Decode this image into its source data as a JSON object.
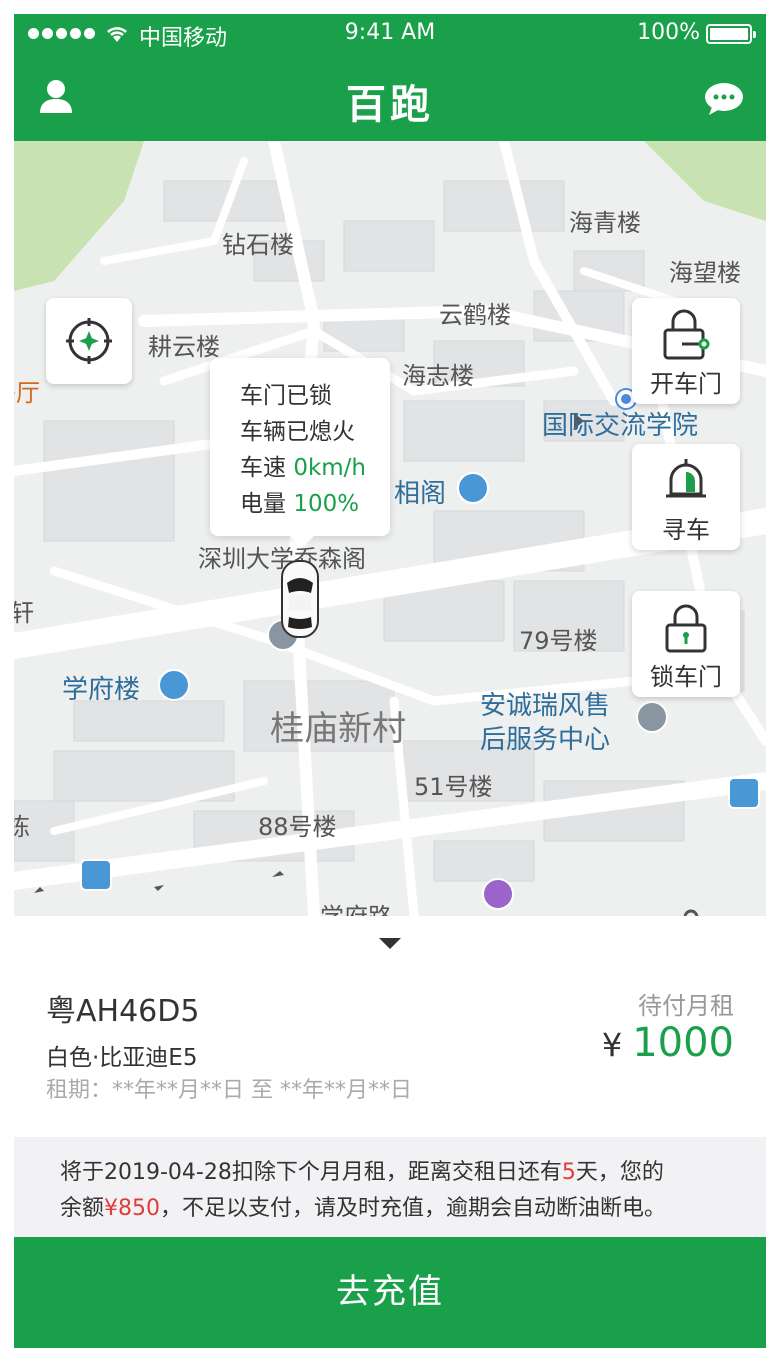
{
  "status_bar": {
    "carrier": "中国移动",
    "time": "9:41 AM",
    "battery": "100%"
  },
  "nav": {
    "title": "百跑"
  },
  "map": {
    "labels": {
      "zuanshi": "钻石楼",
      "haiqing": "海青楼",
      "haiwang": "海望楼",
      "yunhe": "云鹤楼",
      "gengyun": "耕云楼",
      "haizhi": "海志楼",
      "ting": "餐厅",
      "guoji": "国际交流学院",
      "xiangge": "相阁",
      "shenzhen": "深圳大学乔森阁",
      "xuan": "轩",
      "no79": "79号楼",
      "xuefu": "学府楼",
      "guimiao": "桂庙新村",
      "ancheng1": "安诚瑞风售",
      "ancheng2": "后服务中心",
      "no51": "51号楼",
      "no88": "88号楼",
      "dong": "栋",
      "xuefulu": "学府路"
    },
    "actions": {
      "open": "开车门",
      "find": "寻车",
      "lock": "锁车门"
    },
    "popup": {
      "door": "车门已锁",
      "engine": "车辆已熄火",
      "speed_label": "车速",
      "speed_value": "0km/h",
      "battery_label": "电量",
      "battery_value": "100%"
    }
  },
  "vehicle": {
    "plate": "粤AH46D5",
    "model": "白色·比亚迪E5",
    "period": "租期：**年**月**日 至 **年**月**日",
    "rent_label": "待付月租",
    "currency": "¥",
    "rent_amount": "1000"
  },
  "notice": {
    "text1": "将于2019-04-28扣除下个月月租，距离交租日还有",
    "days": "5",
    "text2": "天，您的",
    "text3": "余额",
    "balance": "¥850",
    "text4": "，不足以支付，请及时充值，逾期会自动断油断电。"
  },
  "cta": {
    "label": "去充值"
  },
  "colors": {
    "brand": "#1aa04a",
    "alert": "#e23b3b"
  },
  "icons": [
    "user-icon",
    "message-icon",
    "locate-icon",
    "unlock-icon",
    "bell-icon",
    "lock-icon",
    "car-icon",
    "wifi-icon",
    "battery-icon"
  ]
}
